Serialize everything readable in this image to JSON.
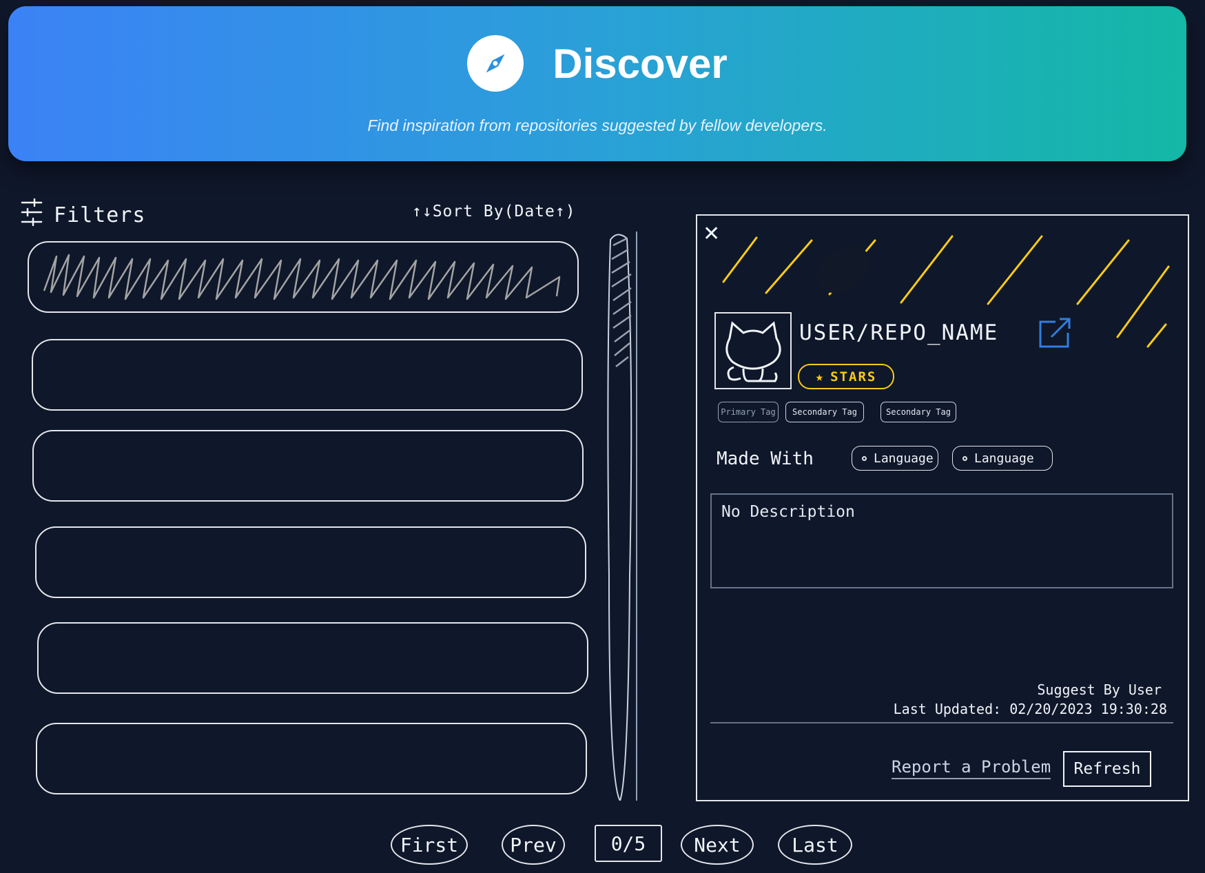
{
  "header": {
    "title": "Discover",
    "subtitle": "Find inspiration from repositories suggested by fellow developers.",
    "icon": "compass-icon"
  },
  "toolbar": {
    "filters_label": "Filters",
    "sort_label": "↑↓Sort By(Date↑)"
  },
  "list": {
    "items": [
      "",
      "",
      "",
      "",
      "",
      ""
    ]
  },
  "detail": {
    "repo_name": "USER/REPO_NAME",
    "stars_label": "STARS",
    "tags": [
      "Primary Tag",
      "Secondary Tag",
      "Secondary Tag"
    ],
    "made_with_label": "Made With",
    "languages": [
      "Language",
      "Language"
    ],
    "description": "No Description",
    "suggested_by": "Suggest By   User",
    "last_updated": "Last Updated: 02/20/2023 19:30:28",
    "report_label": "Report a Problem",
    "refresh_label": "Refresh"
  },
  "pagination": {
    "first": "First",
    "prev": "Prev",
    "counter": "0/5",
    "next": "Next",
    "last": "Last"
  },
  "colors": {
    "background": "#0f172a",
    "banner_start": "#3b82f6",
    "banner_end": "#14b8a6",
    "stars_accent": "#facc15",
    "link_blue": "#2f7fe0",
    "divider_orange": "#f59e0b"
  }
}
